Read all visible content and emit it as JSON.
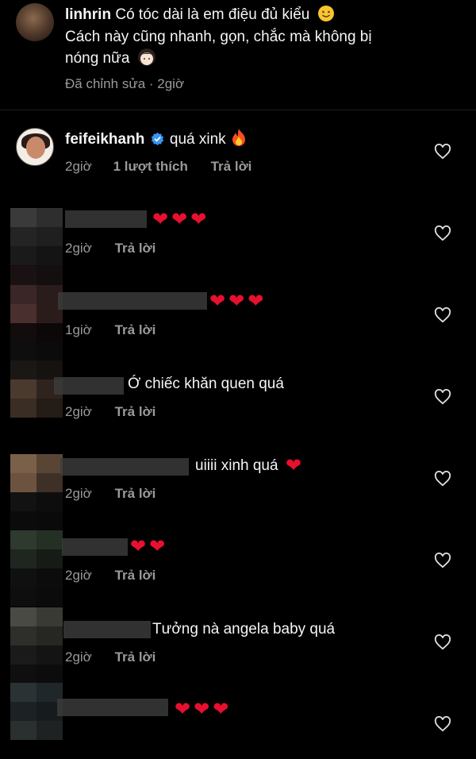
{
  "top_comment": {
    "username": "linhrin",
    "line1": "Có tóc dài là em điệu đủ kiểu",
    "line2": "Cách này cũng nhanh, gọn, chắc mà không bị",
    "line3": "nóng nữa",
    "edited": "Đã chỉnh sửa",
    "time": "2giờ"
  },
  "featured_comment": {
    "username": "feifeikhanh",
    "text": "quá xink",
    "time": "2giờ",
    "likes": "1 lượt thích",
    "reply": "Trả lời"
  },
  "comments": [
    {
      "text": "",
      "hearts": "❤❤❤",
      "time": "2giờ",
      "reply": "Trả lời"
    },
    {
      "text": "",
      "hearts": "❤❤❤",
      "time": "1giờ",
      "reply": "Trả lời"
    },
    {
      "text": "Ớ chiếc khăn quen quá",
      "hearts": "",
      "time": "2giờ",
      "reply": "Trả lời"
    },
    {
      "text": "uiiii xinh quá",
      "hearts": "❤",
      "time": "2giờ",
      "reply": "Trả lời"
    },
    {
      "text": "",
      "hearts": "❤❤",
      "time": "2giờ",
      "reply": "Trả lời"
    },
    {
      "text": "Tưởng nà angela baby quá",
      "hearts": "",
      "time": "2giờ",
      "reply": "Trả lời"
    },
    {
      "text": "",
      "hearts": "❤❤❤",
      "time": "",
      "reply": ""
    }
  ],
  "icons": {
    "like": "heart-outline-icon",
    "verified": "verified-badge-icon",
    "smile": "slightly-smiling-face-icon",
    "fire": "fire-icon",
    "girl": "girl-face-icon"
  },
  "colors": {
    "background": "#000000",
    "text": "#f5f5f5",
    "meta": "#9a9a9a",
    "heart": "#e8102e",
    "verified": "#3897f0"
  }
}
